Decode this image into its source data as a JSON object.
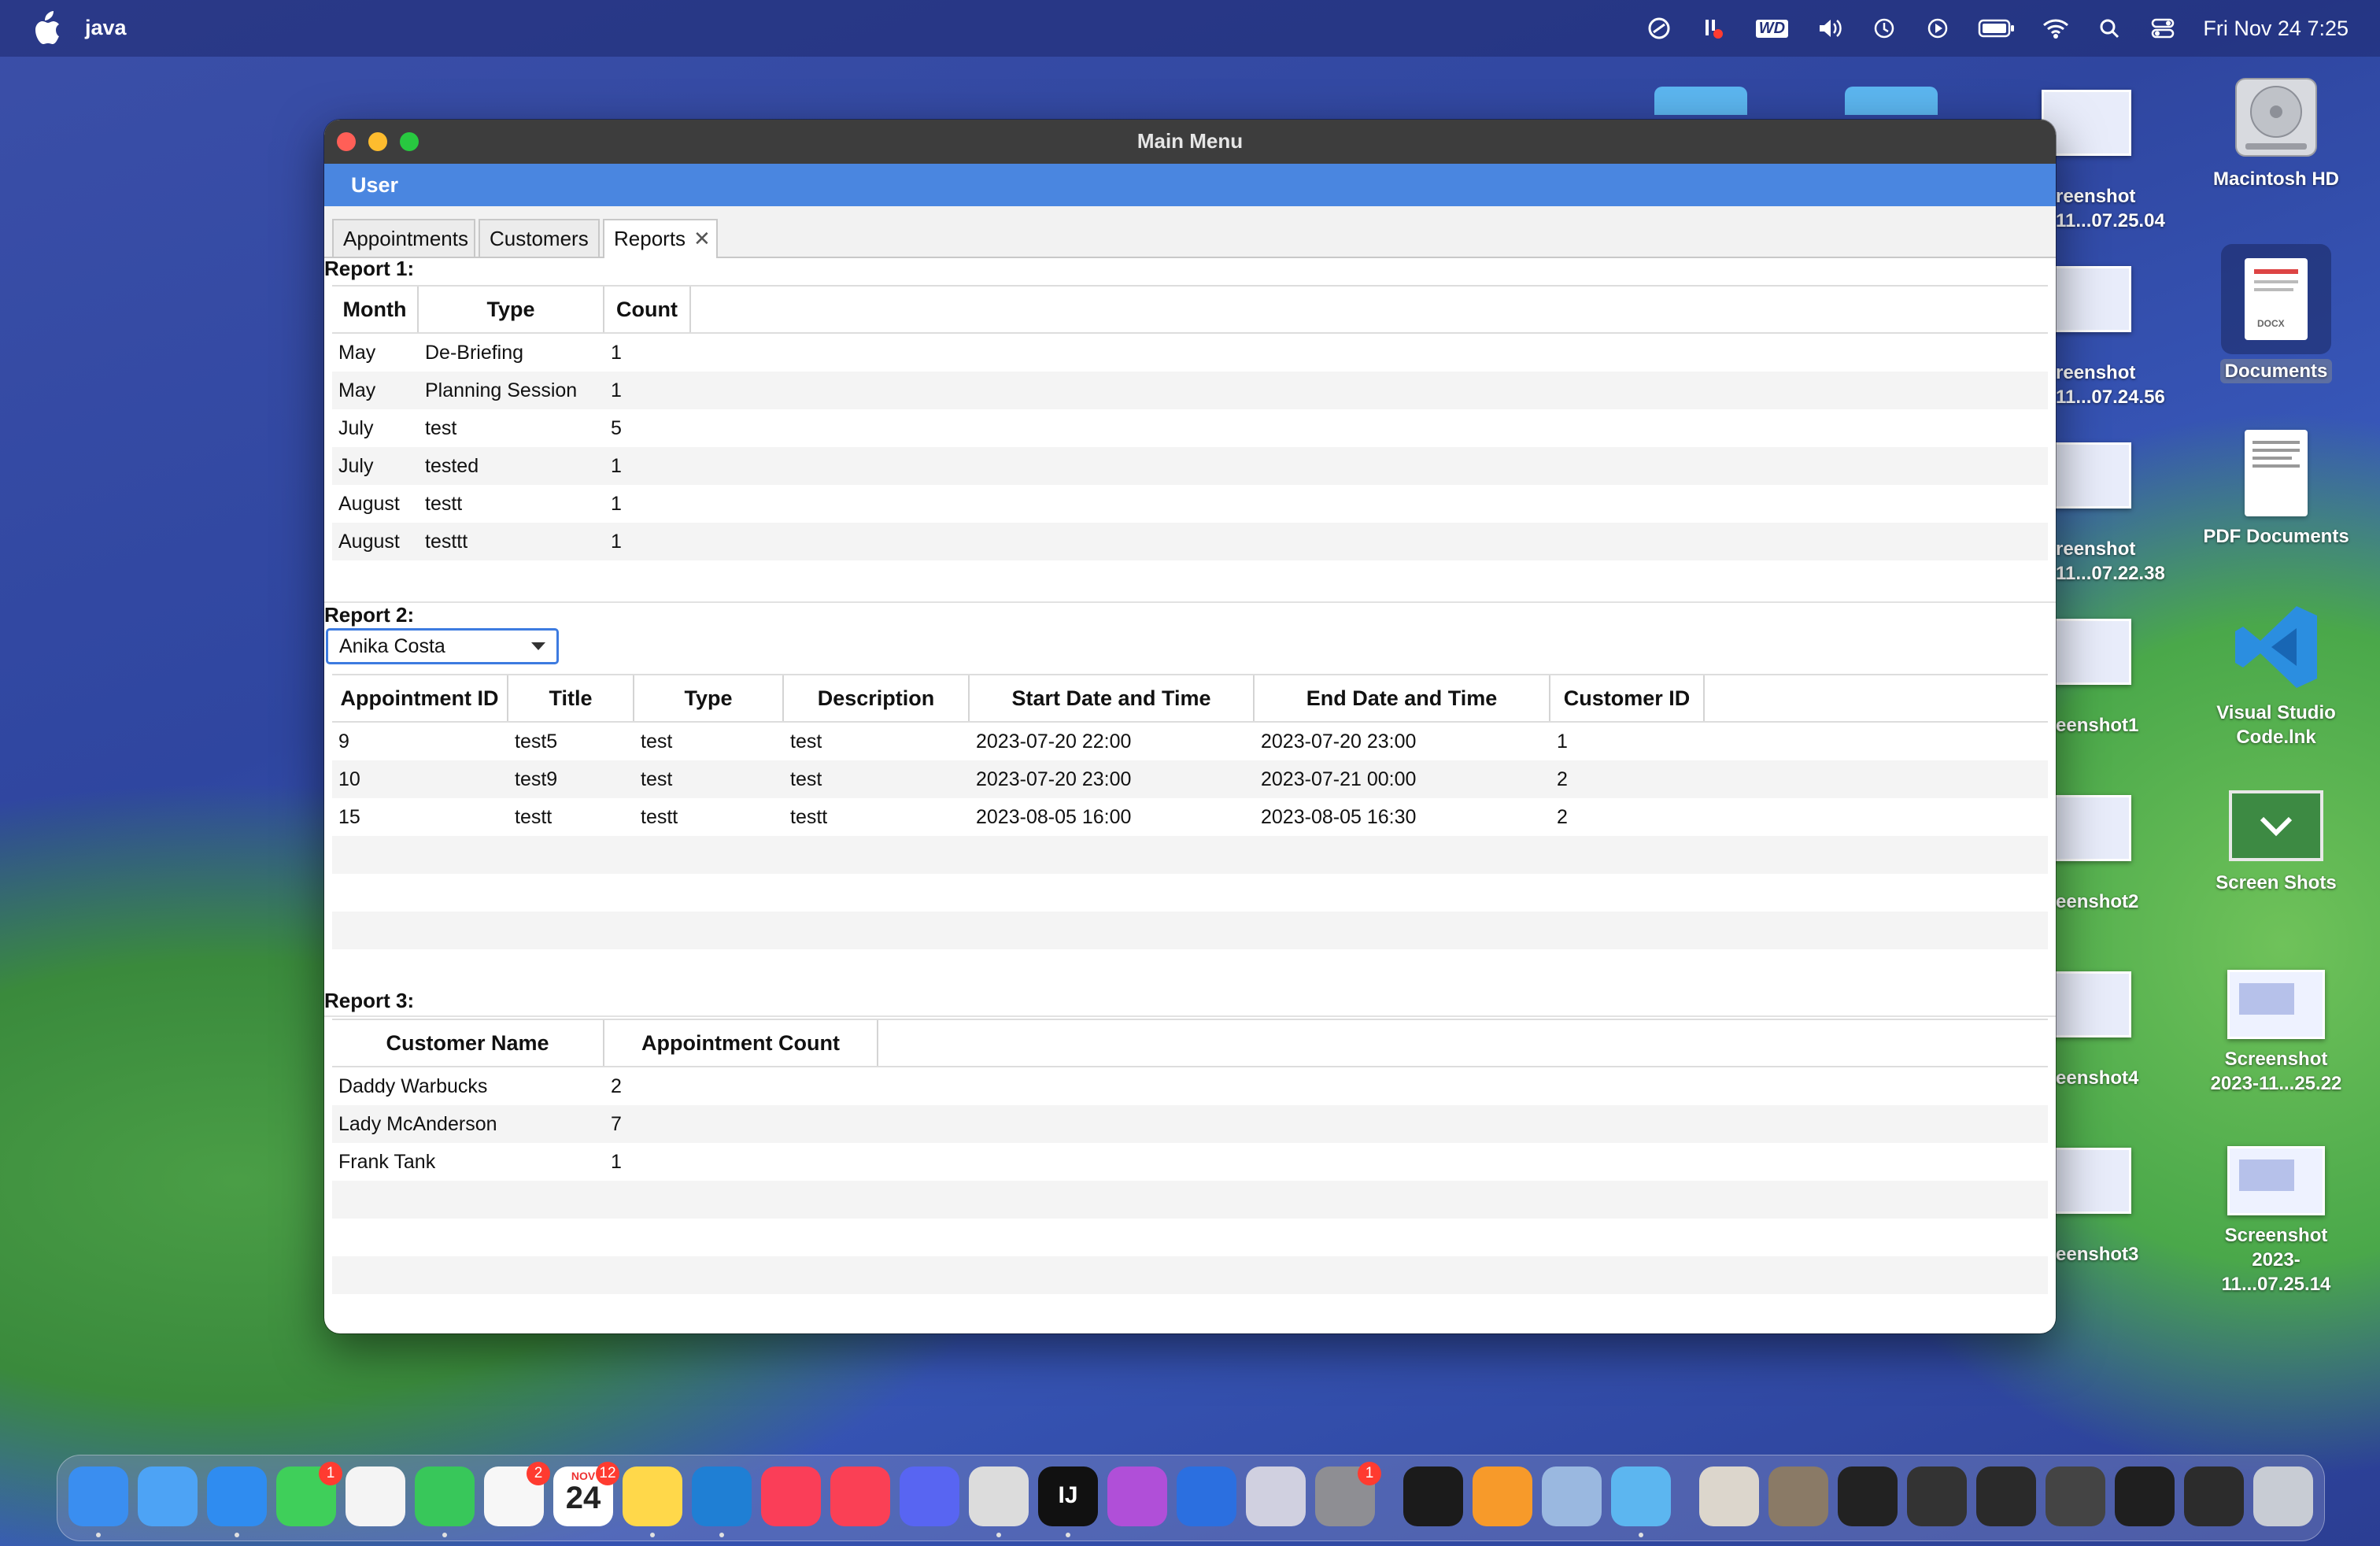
{
  "menubar": {
    "app_name": "java",
    "clock": "Fri Nov 24  7:25",
    "icons": [
      "apple-icon",
      "creative-cloud-icon",
      "bartender-icon",
      "wd-icon",
      "volume-icon",
      "time-machine-icon",
      "play-icon",
      "battery-icon",
      "wifi-icon",
      "search-icon",
      "control-center-icon"
    ],
    "wd_label": "WD"
  },
  "desktop": {
    "right_column": [
      {
        "name": "Macintosh HD",
        "line2": ""
      },
      {
        "name": "Documents",
        "line2": ""
      },
      {
        "name": "PDF Documents",
        "line2": ""
      },
      {
        "name": "Visual Studio",
        "line2": "Code.lnk"
      },
      {
        "name": "Screen Shots",
        "line2": ""
      },
      {
        "name": "Screenshot",
        "line2": "2023-11...25.22"
      },
      {
        "name": "Screenshot",
        "line2": "2023-11...07.25.14"
      }
    ],
    "left_column_partial": [
      {
        "l1": "reenshot",
        "l2": "11...07.25.04"
      },
      {
        "l1": "reenshot",
        "l2": "11...07.24.56"
      },
      {
        "l1": "reenshot",
        "l2": "11...07.22.38"
      },
      {
        "l1": "eenshot1",
        "l2": ""
      },
      {
        "l1": "eenshot2",
        "l2": ""
      },
      {
        "l1": "eenshot4",
        "l2": ""
      },
      {
        "l1": "eenshot3",
        "l2": ""
      }
    ]
  },
  "window": {
    "title": "Main Menu",
    "user_label": "User",
    "tabs": [
      {
        "label": "Appointments"
      },
      {
        "label": "Customers"
      },
      {
        "label": "Reports",
        "close": "✕"
      }
    ]
  },
  "report1": {
    "label": "Report 1:",
    "columns": [
      "Month",
      "Type",
      "Count"
    ],
    "rows": [
      [
        "May",
        "De-Briefing",
        "1"
      ],
      [
        "May",
        "Planning Session",
        "1"
      ],
      [
        "July",
        "test",
        "5"
      ],
      [
        "July",
        "tested",
        "1"
      ],
      [
        "August",
        "testt",
        "1"
      ],
      [
        "August",
        "testtt",
        "1"
      ]
    ]
  },
  "report2": {
    "label": "Report 2:",
    "selected_contact": "Anika Costa",
    "columns": [
      "Appointment ID",
      "Title",
      "Type",
      "Description",
      "Start Date and Time",
      "End Date and Time",
      "Customer ID"
    ],
    "rows": [
      [
        "9",
        "test5",
        "test",
        "test",
        "2023-07-20 22:00",
        "2023-07-20 23:00",
        "1"
      ],
      [
        "10",
        "test9",
        "test",
        "test",
        "2023-07-20 23:00",
        "2023-07-21 00:00",
        "2"
      ],
      [
        "15",
        "testt",
        "testt",
        "testt",
        "2023-08-05 16:00",
        "2023-08-05 16:30",
        "2"
      ]
    ]
  },
  "report3": {
    "label": "Report 3:",
    "columns": [
      "Customer Name",
      "Appointment Count"
    ],
    "rows": [
      [
        "Daddy Warbucks",
        "2"
      ],
      [
        "Lady McAnderson",
        "7"
      ],
      [
        "Frank Tank",
        "1"
      ]
    ]
  },
  "dock": {
    "apps": [
      {
        "name": "finder-icon",
        "color": "#3a8ef0"
      },
      {
        "name": "mail-icon",
        "color": "#4da3f5"
      },
      {
        "name": "safari-icon",
        "color": "#2f8cf0"
      },
      {
        "name": "messages-icon",
        "color": "#3fcf5a",
        "badge": "1"
      },
      {
        "name": "photos-icon",
        "color": "#f4f4f4"
      },
      {
        "name": "facetime-icon",
        "color": "#38c75a"
      },
      {
        "name": "reminders-icon",
        "color": "#f7f7f7",
        "badge": "2"
      },
      {
        "name": "calendar-icon",
        "color": "#ffffff",
        "badge": "12",
        "text": "24",
        "month": "NOV"
      },
      {
        "name": "notes-icon",
        "color": "#ffd84a"
      },
      {
        "name": "vscode-icon",
        "color": "#1f7fd4"
      },
      {
        "name": "music-icon",
        "color": "#fa3e58"
      },
      {
        "name": "news-icon",
        "color": "#fa4055"
      },
      {
        "name": "discord-icon",
        "color": "#5865f2"
      },
      {
        "name": "script-editor-icon",
        "color": "#dcdcdc"
      },
      {
        "name": "intellij-icon",
        "color": "#111111",
        "text": "IJ"
      },
      {
        "name": "configurator-icon",
        "color": "#b04fd8"
      },
      {
        "name": "remote-desktop-icon",
        "color": "#2b6fe0"
      },
      {
        "name": "launchpad-icon",
        "color": "#d0d0e0"
      },
      {
        "name": "system-settings-icon",
        "color": "#8e8e93",
        "badge": "1"
      },
      {
        "name": "terminal-icon",
        "color": "#1b1b1b"
      },
      {
        "name": "pages-icon",
        "color": "#f79a2a"
      },
      {
        "name": "preview-icon",
        "color": "#9ab8e0"
      },
      {
        "name": "folder-icon",
        "color": "#5cb6f0"
      },
      {
        "name": "window-thumb-1-icon",
        "color": "#dcd6cc"
      },
      {
        "name": "window-thumb-2-icon",
        "color": "#8a7a66"
      },
      {
        "name": "window-thumb-3-icon",
        "color": "#222222"
      },
      {
        "name": "window-thumb-4-icon",
        "color": "#333333"
      },
      {
        "name": "window-thumb-5-icon",
        "color": "#2a2a2a"
      },
      {
        "name": "window-thumb-6-icon",
        "color": "#444444"
      },
      {
        "name": "window-thumb-7-icon",
        "color": "#1f1f1f"
      },
      {
        "name": "window-thumb-8-icon",
        "color": "#2c2c2c"
      },
      {
        "name": "trash-icon",
        "color": "#c8ccd4"
      }
    ]
  }
}
